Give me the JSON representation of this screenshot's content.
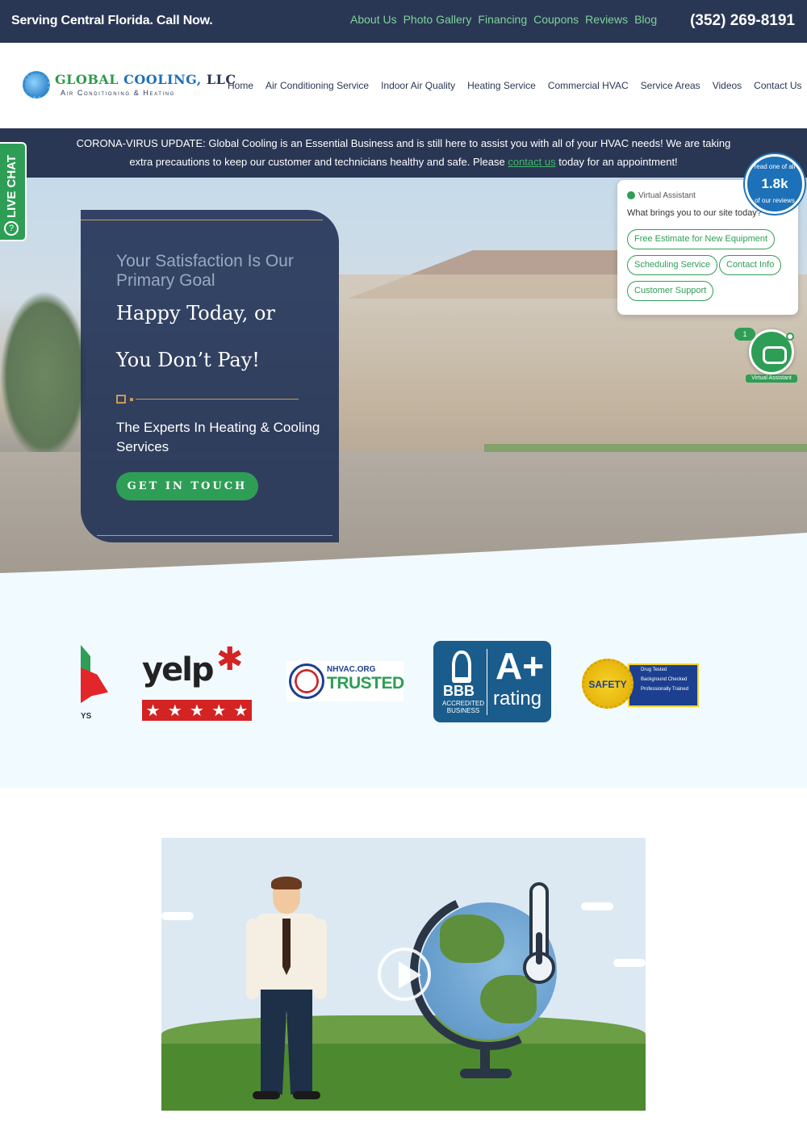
{
  "topbar": {
    "tagline": "Serving Central Florida. Call Now.",
    "links": [
      "About Us",
      "Photo Gallery",
      "Financing",
      "Coupons",
      "Reviews",
      "Blog"
    ],
    "phone": "(352) 269-8191"
  },
  "logo": {
    "name_part1": "GLOBAL",
    "name_part2": "COOLING,",
    "name_part3": "LLC",
    "subtitle": "Air Conditioning & Heating"
  },
  "nav": [
    "Home",
    "Air Conditioning Service",
    "Indoor Air Quality",
    "Heating Service",
    "Commercial HVAC",
    "Service Areas",
    "Videos",
    "Contact Us"
  ],
  "corona": {
    "line1": "CORONA-VIRUS UPDATE: Global Cooling is an Essential Business and is still here to assist you with all of your HVAC needs! We are taking",
    "line2_before": "extra precautions to keep our customer and technicians healthy and safe. Please",
    "link": "contact us",
    "line2_after": "today for an appointment!"
  },
  "hero": {
    "subheading": "Your Satisfaction Is Our Primary Goal",
    "headline1": "Happy Today, or",
    "headline2": "You Don’t Pay!",
    "tagline": "The Experts In Heating & Cooling Services",
    "button": "GET IN TOUCH"
  },
  "live_chat": {
    "label": "LIVE CHAT"
  },
  "assistant": {
    "title": "Virtual Assistant",
    "question": "What brings you to our site today?",
    "options": [
      "Free Estimate for New Equipment",
      "Scheduling Service",
      "Contact Info",
      "Customer Support"
    ],
    "badge_count": "1",
    "bot_label": "Virtual Assistant"
  },
  "reviews_badge": {
    "top": "read one of all",
    "count": "1.8k",
    "bottom": "of our reviews"
  },
  "badges": {
    "partial_text": "YS",
    "yelp_word": "yelp",
    "nhvac_org": "NHVAC.ORG",
    "nhvac_trusted": "TRUSTED",
    "bbb": "BBB",
    "bbb_accredited": "ACCREDITED BUSINESS",
    "bbb_grade": "A+",
    "bbb_rating": "rating",
    "safety_seal": "SAFETY",
    "safety_items": [
      "Drug Tested",
      "Background Checked",
      "Professionally Trained"
    ]
  },
  "colors": {
    "navy": "#2a3754",
    "green": "#2e9e56",
    "accent_gold": "#c89a5a",
    "band_bg": "#f1faff"
  }
}
